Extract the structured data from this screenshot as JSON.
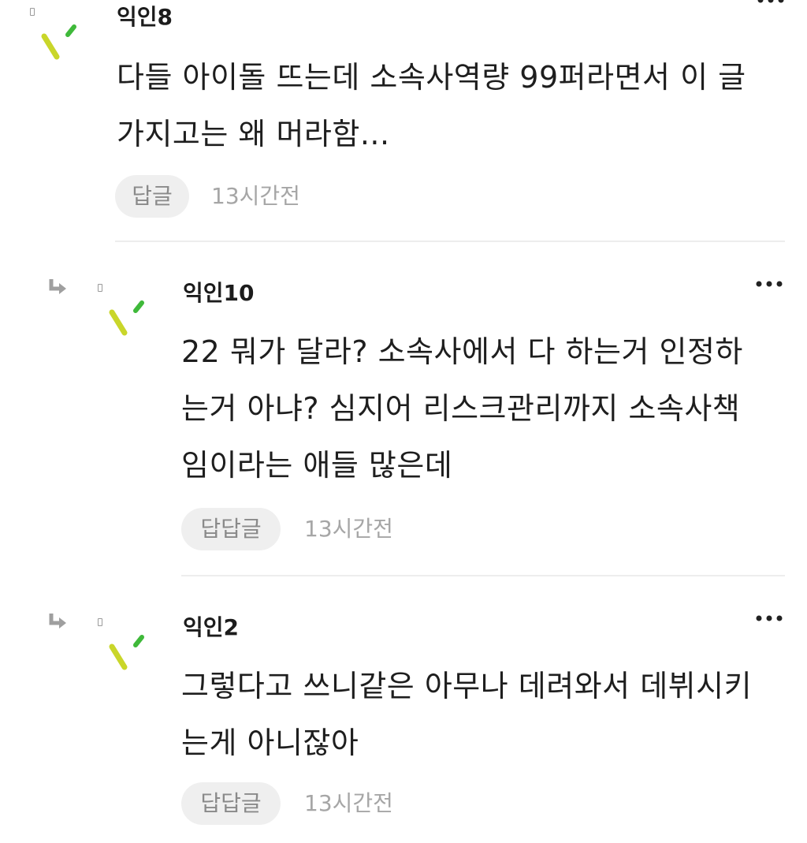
{
  "comments": [
    {
      "author": "익인8",
      "lines": [
        "다들 아이돌 뜨는데 소속사역량 99퍼라면서 이 글",
        "가지고는 왜 머라함..."
      ],
      "reply_label": "답글",
      "time": "13시간전"
    },
    {
      "author": "익인10",
      "lines": [
        "22 뭐가 달라? 소속사에서 다 하는거 인정하",
        "는거 아냐? 심지어 리스크관리까지 소속사책",
        "임이라는 애들 많은데"
      ],
      "reply_label": "답답글",
      "time": "13시간전"
    },
    {
      "author": "익인2",
      "lines": [
        "그렇다고 쓰니같은 아무나 데려와서 데뷔시키",
        "는게 아니잖아"
      ],
      "reply_label": "답답글",
      "time": "13시간전"
    }
  ],
  "colors": {
    "avatar_yellow": "#c9d62a",
    "avatar_green": "#3fb93a",
    "reply_bg": "#efefef",
    "time_text": "#a6a6a6"
  },
  "icons": {
    "avatar": "anonymous-avatar-icon",
    "reply_arrow": "reply-arrow-icon",
    "more": "more-dots-icon"
  }
}
